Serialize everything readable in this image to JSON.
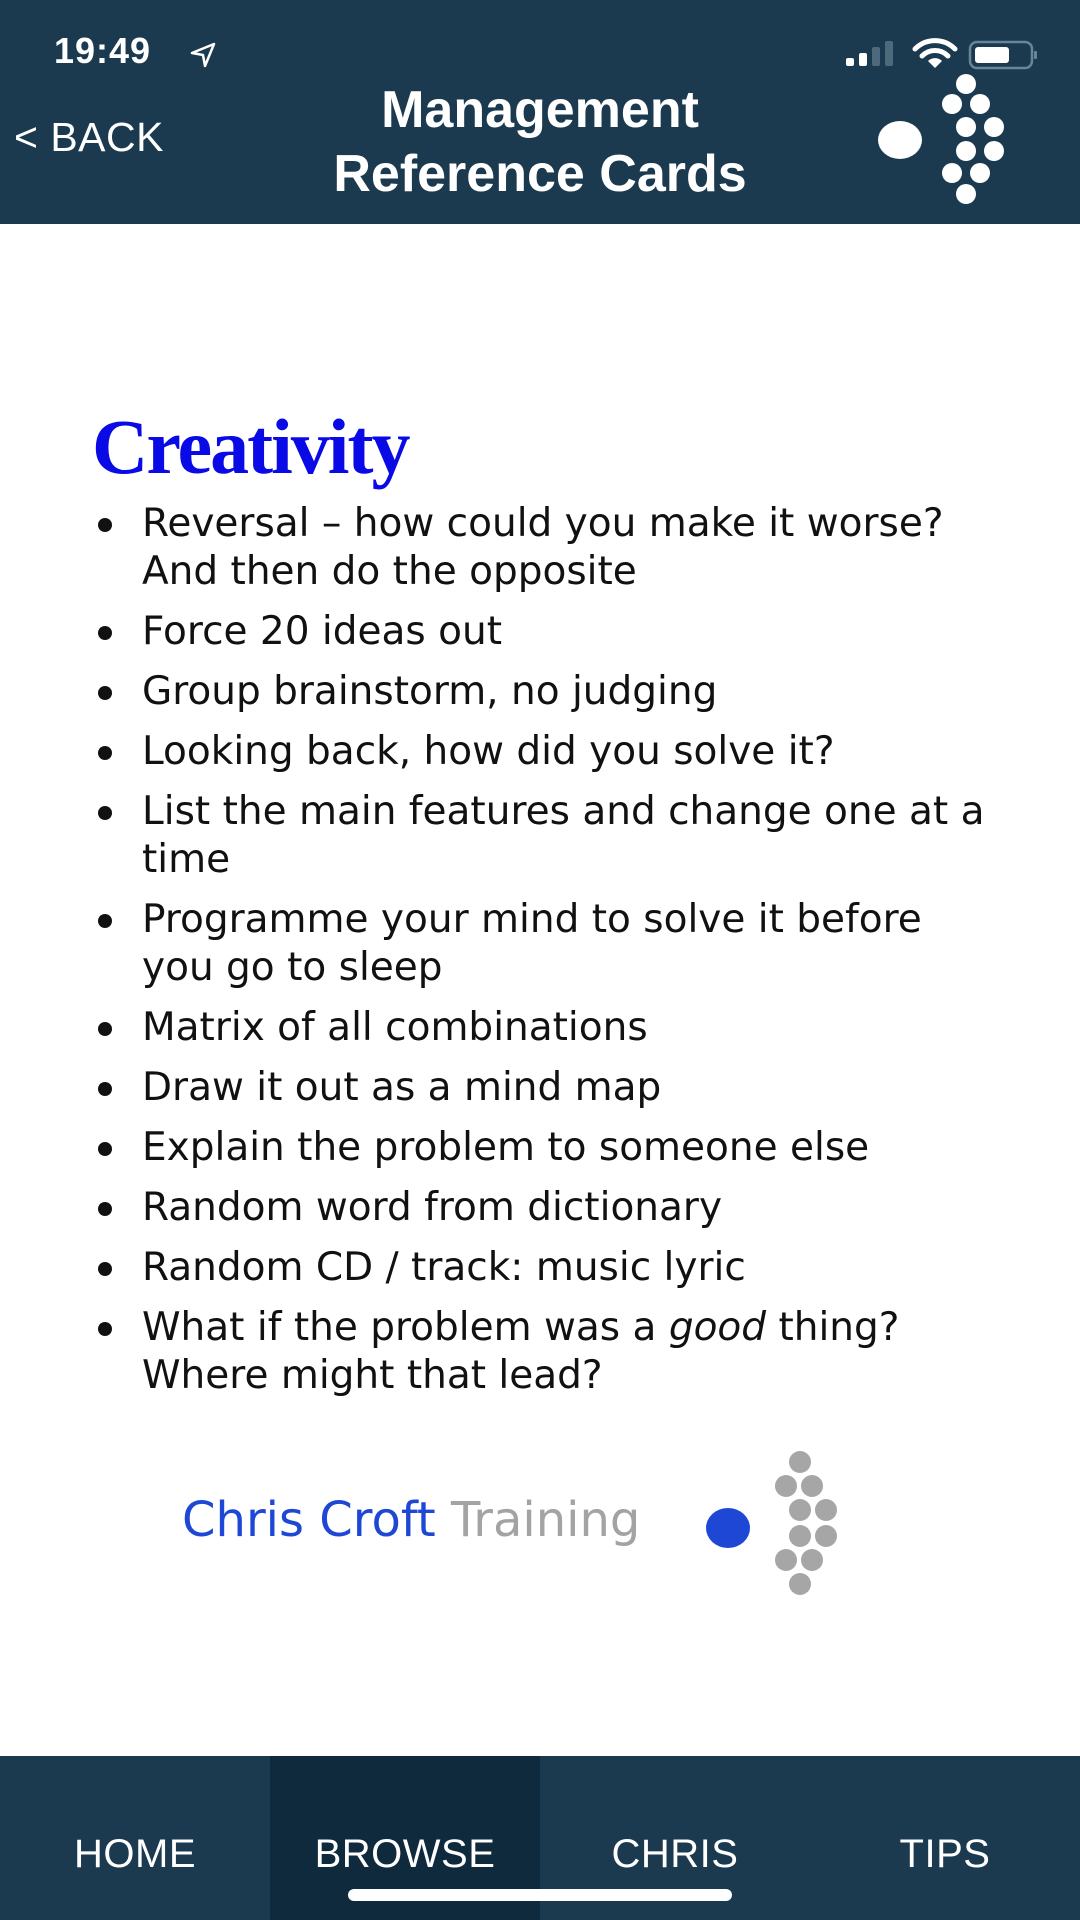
{
  "status_bar": {
    "time": "19:49",
    "icons": [
      "location-arrow-icon",
      "cellular-signal-icon",
      "wifi-icon",
      "battery-icon"
    ]
  },
  "header": {
    "back_label": "< BACK",
    "title_line1": "Management",
    "title_line2": "Reference Cards",
    "logo": "chris-croft-dots-logo",
    "background_color": "#1b3a4f"
  },
  "card": {
    "title": "Creativity",
    "title_color": "#0a0ae6",
    "bullets": [
      "Reversal – how could you make it worse?  And then do the opposite",
      "Force 20 ideas out",
      "Group brainstorm, no judging",
      "Looking back, how did you solve it?",
      "List the main features and change one at a time",
      "Programme your mind to solve it before you go to sleep",
      "Matrix of all combinations",
      "Draw it out as a mind map",
      "Explain the problem to someone else",
      "Random word from dictionary",
      "Random CD / track: music lyric"
    ],
    "last_bullet": {
      "before": "What if the problem was a ",
      "emphasis": "good",
      "after": " thing?  Where might that lead?"
    },
    "brand": {
      "part1": "Chris Croft",
      "part2": "Training",
      "part1_color": "#1f47d6",
      "part2_color": "#a3a3a3"
    }
  },
  "tabbar": {
    "tabs": [
      {
        "label": "HOME",
        "active": false
      },
      {
        "label": "BROWSE",
        "active": true
      },
      {
        "label": "CHRIS",
        "active": false
      },
      {
        "label": "TIPS",
        "active": false
      }
    ]
  }
}
